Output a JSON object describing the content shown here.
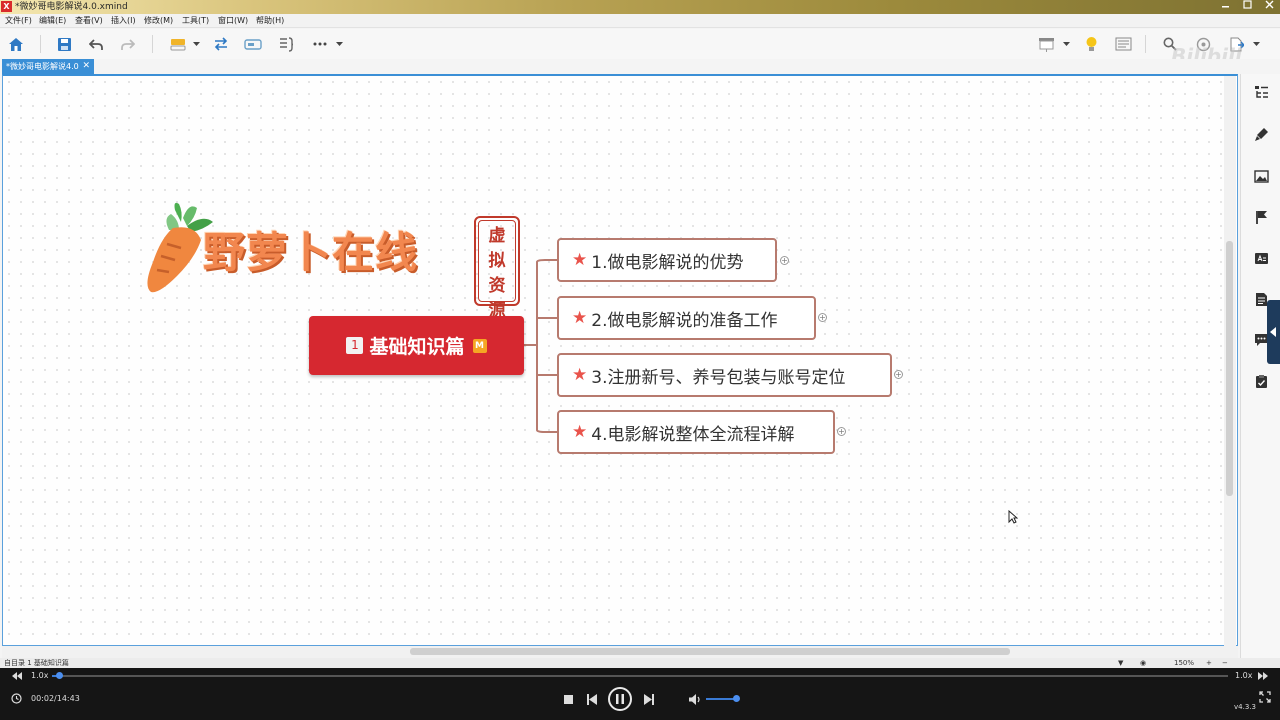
{
  "window": {
    "title": "*微妙哥电影解说4.0.xmind",
    "app_icon": "X"
  },
  "menu": [
    "文件(F)",
    "编辑(E)",
    "查看(V)",
    "插入(I)",
    "修改(M)",
    "工具(T)",
    "窗口(W)",
    "帮助(H)"
  ],
  "tab": {
    "label": "*微妙哥电影解说4.0",
    "close": "✕"
  },
  "watermark": "Bilibili",
  "mindmap": {
    "logo": "野萝卜在线",
    "seal": [
      "虚",
      "拟",
      "资",
      "源"
    ],
    "root": {
      "number": "1",
      "label": "基础知识篇",
      "badge": "M"
    },
    "topics": [
      {
        "label": "1.做电影解说的优势"
      },
      {
        "label": "2.做电影解说的准备工作"
      },
      {
        "label": "3.注册新号、养号包装与账号定位"
      },
      {
        "label": "4.电影解说整体全流程详解"
      }
    ],
    "expand_symbol": "+"
  },
  "statusbar": {
    "left": "自目录  1 基础知识篇",
    "zoom": "150%"
  },
  "player": {
    "speed_left": "1.0x",
    "speed_right": "1.0x",
    "time": "00:02/14:43",
    "version": "v4.3.3",
    "progress": 0.003
  },
  "colors": {
    "root_fill": "#d62830",
    "topic_border": "#b77a6e",
    "star": "#e9534b",
    "connector": "#b77a6e",
    "accent": "#3a8fd6"
  }
}
